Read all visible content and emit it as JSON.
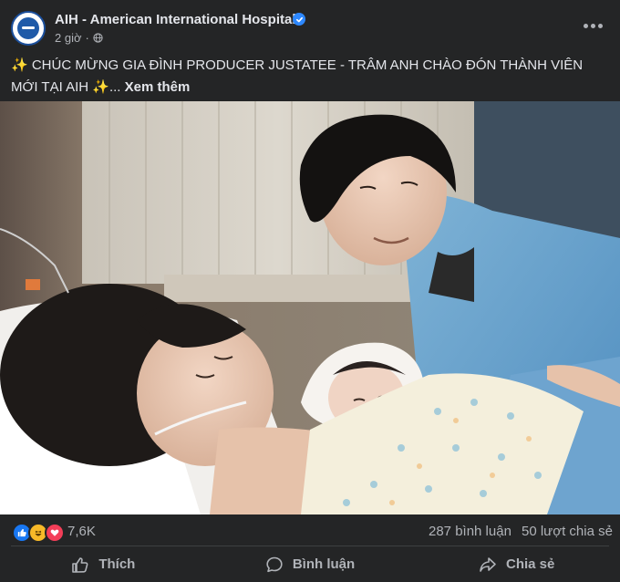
{
  "post": {
    "page_name": "AIH - American International Hospital",
    "time": "2 giờ",
    "caption": "✨ CHÚC MỪNG GIA ĐÌNH PRODUCER JUSTATEE - TRÂM ANH CHÀO ĐÓN THÀNH VIÊN MỚI TẠI AIH ✨...",
    "see_more": "Xem thêm"
  },
  "reactions": {
    "count": "7,6K",
    "comments": "287 bình luận",
    "shares": "50 lượt chia sẻ",
    "types": [
      "like-icon",
      "haha-icon",
      "love-icon"
    ]
  },
  "actions": {
    "like": "Thích",
    "comment": "Bình luận",
    "share": "Chia sẻ"
  },
  "colors": {
    "background": "#242526",
    "text_primary": "#e4e6eb",
    "text_secondary": "#b0b3b8",
    "verified": "#2d88ff",
    "like_blue": "#1877f2",
    "love_red": "#f33e58",
    "haha_yellow": "#f7b928"
  }
}
